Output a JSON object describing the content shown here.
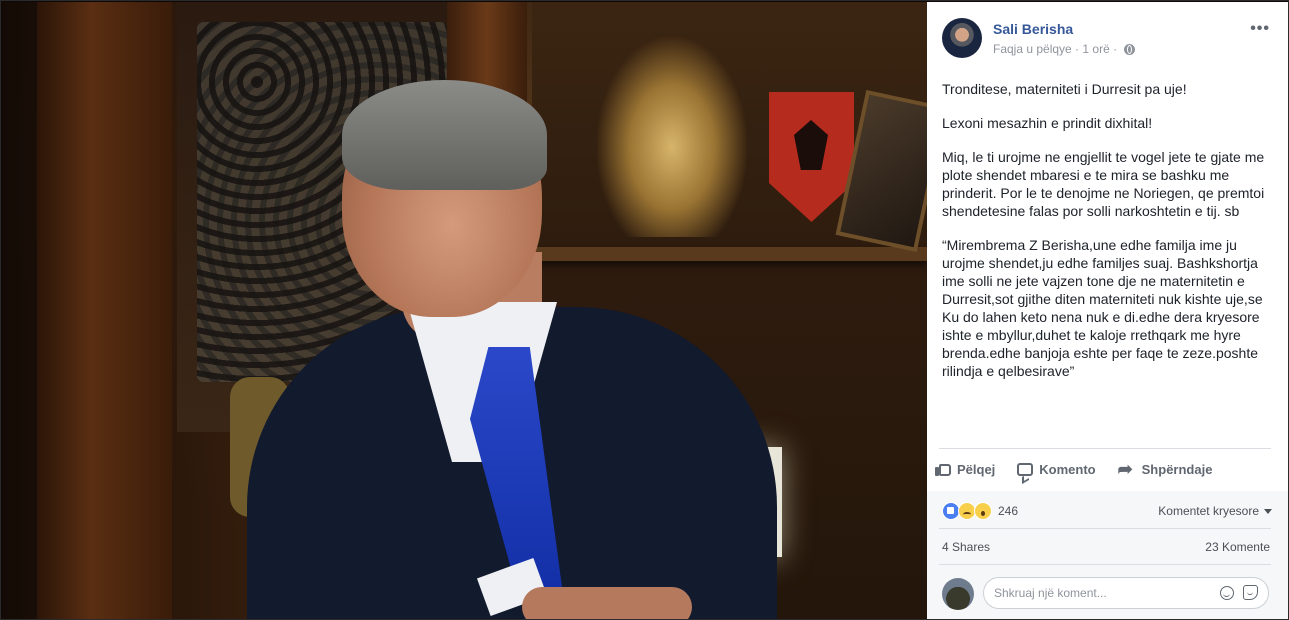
{
  "post": {
    "author": "Sali Berisha",
    "meta_text": "Faqja u pëlqye · 1 orë ·",
    "more": "•••",
    "paragraphs": [
      "Tronditese, materniteti i Durresit pa uje!",
      "Lexoni mesazhin e prindit dixhital!",
      "Miq, le ti urojme ne engjellit te vogel jete te gjate me plote shendet mbaresi e te mira se bashku me prinderit. Por le te denojme ne Noriegen, qe premtoi shendetesine falas por solli narkoshtetin e tij. sb",
      "“Mirembrema Z Berisha,une edhe familja ime ju urojme shendet,ju edhe familjes suaj. Bashkshortja ime solli ne jete vajzen tone dje ne maternitetin e Durresit,sot gjithe diten materniteti nuk kishte uje,se Ku do lahen keto nena nuk e di.edhe dera kryesore ishte e mbyllur,duhet te kaloje rrethqark me hyre brenda.edhe banjoja eshte per faqe te zeze.poshte rilindja e qelbesirave”"
    ]
  },
  "actions": {
    "like": "Pëlqej",
    "comment": "Komento",
    "share": "Shpërndaje"
  },
  "stats": {
    "reaction_icons": [
      "like",
      "sad",
      "wow"
    ],
    "reaction_count": "246",
    "filter": "Komentet kryesore",
    "shares": "4 Shares",
    "comments": "23 Komente"
  },
  "composer": {
    "placeholder": "Shkruaj një koment..."
  }
}
